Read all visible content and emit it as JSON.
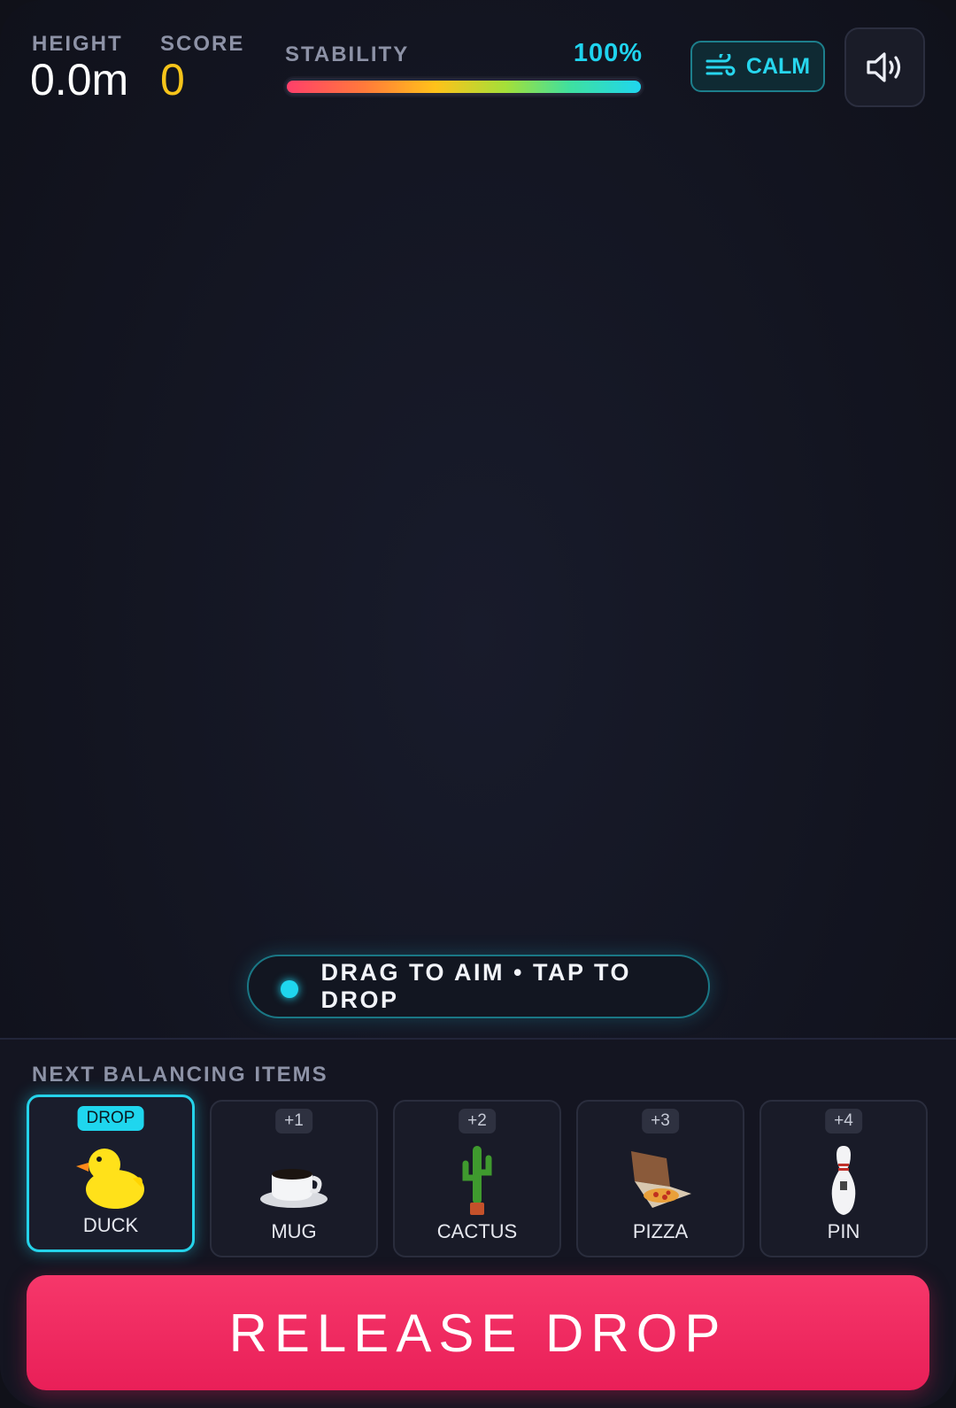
{
  "hud": {
    "height_label": "HEIGHT",
    "height_value": "0.0m",
    "score_label": "SCORE",
    "score_value": "0",
    "stability_label": "STABILITY",
    "stability_value": "100%",
    "stability_fraction": 1.0,
    "wind_label": "CALM",
    "wind_icon": "wind-icon",
    "sound_icon": "speaker-icon"
  },
  "hint": {
    "text": "DRAG TO AIM • TAP TO DROP"
  },
  "queue": {
    "title": "NEXT BALANCING ITEMS",
    "items": [
      {
        "badge": "DROP",
        "name": "DUCK",
        "icon": "duck-icon",
        "active": true
      },
      {
        "badge": "+1",
        "name": "MUG",
        "icon": "mug-icon",
        "active": false
      },
      {
        "badge": "+2",
        "name": "CACTUS",
        "icon": "cactus-icon",
        "active": false
      },
      {
        "badge": "+3",
        "name": "PIZZA",
        "icon": "pizza-icon",
        "active": false
      },
      {
        "badge": "+4",
        "name": "PIN",
        "icon": "bowling-pin-icon",
        "active": false
      }
    ]
  },
  "release_button": {
    "label": "RELEASE DROP"
  },
  "colors": {
    "accent": "#1fd6ee",
    "score": "#f6c41a",
    "release": "#ec2a5f",
    "background": "#131521"
  }
}
